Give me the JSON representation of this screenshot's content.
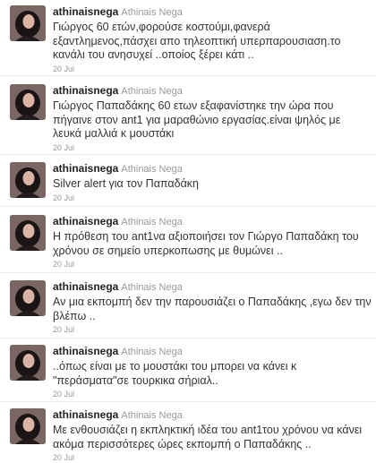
{
  "tweets": [
    {
      "screen_name": "athinaisnega",
      "full_name": "Athinais Nega",
      "text": "Γιώργος 60 ετών,φορούσε κοστούμι,φανερά εξαντλημενος,πάσχει απο τηλεοπτική υπερπαρουσιαση.το κανάλι του ανησυχεί ..οποίος ξέρει κάτι ..",
      "time": "20 Jul"
    },
    {
      "screen_name": "athinaisnega",
      "full_name": "Athinais Nega",
      "text": "Γιώργος Παπαδάκης 60 ετων εξαφανίστηκε την ώρα που πήγαινε στον ant1 για μαραθώνιο εργασίας.είναι ψηλός με λευκά μαλλιά κ μουστάκι",
      "time": "20 Jul"
    },
    {
      "screen_name": "athinaisnega",
      "full_name": "Athinais Nega",
      "text": "Silver alert για τον Παπαδάκη",
      "time": "20 Jul"
    },
    {
      "screen_name": "athinaisnega",
      "full_name": "Athinais Nega",
      "text": "Η πρόθεση του ant1να αξιοποιήσει τον Γιώργο Παπαδάκη του χρόνου σε σημείο υπερκοπωσης με θυμώνει ..",
      "time": "20 Jul"
    },
    {
      "screen_name": "athinaisnega",
      "full_name": "Athinais Nega",
      "text": "Αν μια εκπομπή δεν την παρουσιάζει ο Παπαδάκης ,εγω δεν την βλέπω ..",
      "time": "20 Jul"
    },
    {
      "screen_name": "athinaisnega",
      "full_name": "Athinais Nega",
      "text": "..όπως είναι με το μουστάκι του μπορει να κάνει κ \"περάσματα\"σε τουρκικα σήριαλ..",
      "time": "20 Jul"
    },
    {
      "screen_name": "athinaisnega",
      "full_name": "Athinais Nega",
      "text": "Με ενθουσιάζει η εκπληκτική ιδέα του ant1του χρόνου να κάνει ακόμα περισσότερες ώρες εκπομπή ο Παπαδάκης ..",
      "time": "20 Jul"
    }
  ]
}
